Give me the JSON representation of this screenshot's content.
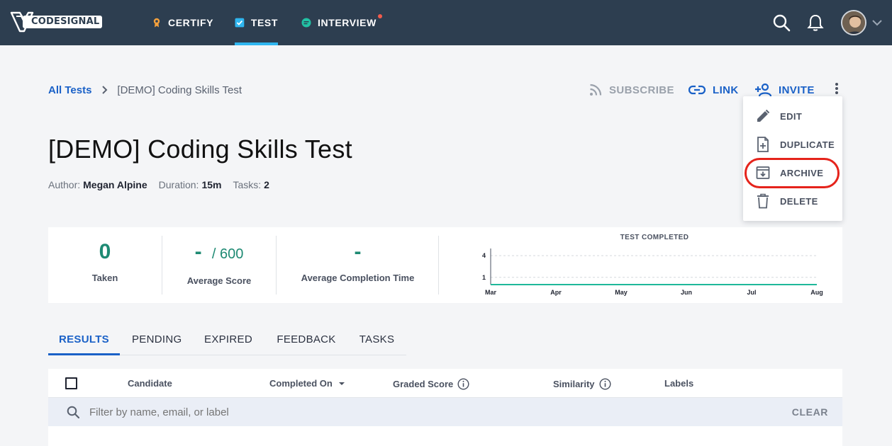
{
  "nav": {
    "brand": "CODESIGNAL",
    "items": [
      {
        "label": "CERTIFY",
        "icon": "certificate-icon"
      },
      {
        "label": "TEST",
        "icon": "test-checkbox-icon",
        "active": true
      },
      {
        "label": "INTERVIEW",
        "icon": "interview-chat-icon",
        "notification": true
      }
    ],
    "accent_color": "#2fb6f0",
    "bg_color": "#2d3e50"
  },
  "breadcrumb": {
    "parent": "All Tests",
    "current": "[DEMO] Coding Skills Test"
  },
  "actions": {
    "subscribe": "SUBSCRIBE",
    "link": "LINK",
    "invite": "INVITE"
  },
  "menu": {
    "items": [
      {
        "label": "EDIT",
        "icon": "pencil-icon"
      },
      {
        "label": "DUPLICATE",
        "icon": "duplicate-file-icon"
      },
      {
        "label": "ARCHIVE",
        "icon": "archive-box-icon",
        "highlighted": true
      },
      {
        "label": "DELETE",
        "icon": "trash-icon"
      }
    ]
  },
  "test": {
    "title": "[DEMO] Coding Skills Test",
    "author_label": "Author:",
    "author": "Megan Alpine",
    "duration_label": "Duration:",
    "duration": "15m",
    "tasks_label": "Tasks:",
    "tasks": "2"
  },
  "stats": {
    "taken_value": "0",
    "taken_label": "Taken",
    "avg_score_value": "-",
    "avg_score_max": "/ 600",
    "avg_score_label": "Average Score",
    "avg_time_value": "-",
    "avg_time_label": "Average Completion Time"
  },
  "chart_data": {
    "type": "line",
    "title": "TEST COMPLETED",
    "categories": [
      "Mar",
      "Apr",
      "May",
      "Jun",
      "Jul",
      "Aug"
    ],
    "y_ticks": [
      "4",
      "1"
    ],
    "series": [
      {
        "values": [
          0,
          0,
          0,
          0,
          0,
          0
        ]
      }
    ],
    "color": "#1fb89a"
  },
  "tabs": [
    "RESULTS",
    "PENDING",
    "EXPIRED",
    "FEEDBACK",
    "TASKS"
  ],
  "table": {
    "headers": [
      "Candidate",
      "Completed On",
      "Graded Score",
      "Similarity",
      "Labels"
    ],
    "filter_placeholder": "Filter by name, email, or label",
    "clear_label": "CLEAR"
  }
}
